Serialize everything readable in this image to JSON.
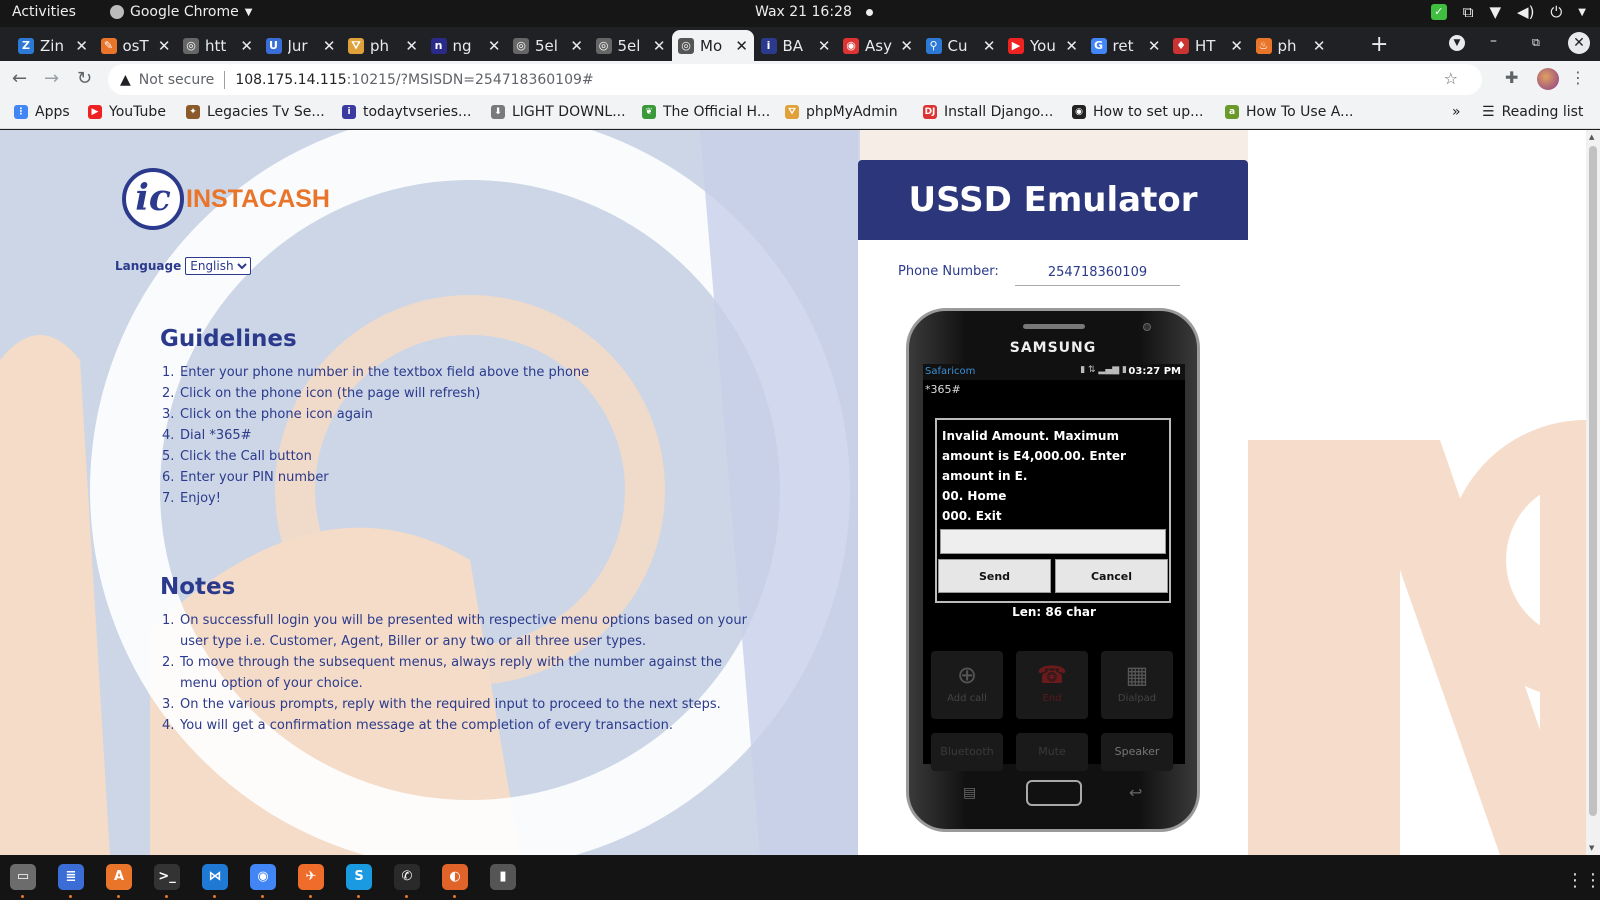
{
  "topbar": {
    "activities": "Activities",
    "app": "Google Chrome",
    "clock": "Wax 21  16:28"
  },
  "tabs": [
    {
      "title": "Zin",
      "fav": "Z",
      "color": "#2d7ad6"
    },
    {
      "title": "osT",
      "fav": "✎",
      "color": "#e8752a"
    },
    {
      "title": "htt",
      "fav": "◎",
      "color": "#666"
    },
    {
      "title": "Jur",
      "fav": "U",
      "color": "#3a6ed6"
    },
    {
      "title": "ph",
      "fav": "⛛",
      "color": "#e0a03a"
    },
    {
      "title": "ng",
      "fav": "n",
      "color": "#2a2a8a"
    },
    {
      "title": "5el",
      "fav": "◎",
      "color": "#666"
    },
    {
      "title": "5el",
      "fav": "◎",
      "color": "#666"
    },
    {
      "title": "Mo",
      "fav": "◎",
      "color": "#555"
    },
    {
      "title": "BA",
      "fav": "i",
      "color": "#2b3a8c"
    },
    {
      "title": "Asy",
      "fav": "◉",
      "color": "#d33"
    },
    {
      "title": "Cu",
      "fav": "⚲",
      "color": "#2d7ad6"
    },
    {
      "title": "You",
      "fav": "▶",
      "color": "#e22"
    },
    {
      "title": "ret",
      "fav": "G",
      "color": "#4285f4"
    },
    {
      "title": "HT",
      "fav": "♦",
      "color": "#c33"
    },
    {
      "title": "ph",
      "fav": "♨",
      "color": "#e8752a"
    }
  ],
  "omnibox": {
    "security": "Not secure",
    "host": "108.175.14.115",
    "path": ":10215/?MSISDN=254718360109#"
  },
  "bookmarks": [
    {
      "label": "Apps",
      "fav": "⋮",
      "color": "#4285f4"
    },
    {
      "label": "YouTube",
      "fav": "▶",
      "color": "#e22"
    },
    {
      "label": "Legacies Tv Se...",
      "fav": "✦",
      "color": "#8a5a2a"
    },
    {
      "label": "todaytvseries...",
      "fav": "i",
      "color": "#3a3aa0"
    },
    {
      "label": "LIGHT DOWNL...",
      "fav": "⬇",
      "color": "#7a7a7a"
    },
    {
      "label": "The Official H...",
      "fav": "❦",
      "color": "#3a9a3a"
    },
    {
      "label": "phpMyAdmin",
      "fav": "⛛",
      "color": "#e0a03a"
    },
    {
      "label": "Install Django...",
      "fav": "DJ",
      "color": "#d33"
    },
    {
      "label": "How to set up...",
      "fav": "◉",
      "color": "#222"
    },
    {
      "label": "How To Use A...",
      "fav": "a",
      "color": "#6a9a2a"
    }
  ],
  "bookmarks_more": "»",
  "reading_list": "Reading list",
  "page": {
    "logo_mark": "ic",
    "logo_text": "INSTACASH",
    "language_label": "Language",
    "language_selected": "English",
    "guidelines_title": "Guidelines",
    "guidelines": [
      "Enter your phone number in the textbox field above the phone",
      "Click on the phone icon (the page will refresh)",
      "Click on the phone icon again",
      "Dial *365#",
      "Click the Call button",
      "Enter your PIN number",
      "Enjoy!"
    ],
    "notes_title": "Notes",
    "notes": [
      "On successfull login you will be presented with respective menu options based on your user type i.e. Customer, Agent, Biller or any two or all three user types.",
      "To move through the subsequent menus, always reply with the number against the menu option of your choice.",
      "On the various prompts, reply with the required input to proceed to the next steps.",
      "You will get a confirmation message at the completion of every transaction."
    ]
  },
  "emulator": {
    "title": "USSD Emulator",
    "phone_label": "Phone Number:",
    "phone_value": "254718360109",
    "brand": "SAMSUNG",
    "carrier": "Safaricom",
    "time": "03:27 PM",
    "dial": "*365#",
    "message": [
      "Invalid Amount. Maximum",
      "amount is E4,000.00. Enter",
      "amount in E.",
      "00. Home",
      "000. Exit"
    ],
    "send": "Send",
    "cancel": "Cancel",
    "length": "Len: 86 char",
    "call_buttons": [
      "Add call",
      "End",
      "Dialpad",
      "Bluetooth",
      "Mute",
      "Speaker"
    ]
  },
  "dock": [
    {
      "name": "files",
      "glyph": "▭",
      "color": "#6c6c6c"
    },
    {
      "name": "text-editor",
      "glyph": "≣",
      "color": "#3a6ed6"
    },
    {
      "name": "software",
      "glyph": "A",
      "color": "#e8752a"
    },
    {
      "name": "terminal",
      "glyph": ">_",
      "color": "#333"
    },
    {
      "name": "vscode",
      "glyph": "⋈",
      "color": "#1f7ad6"
    },
    {
      "name": "chrome",
      "glyph": "◉",
      "color": "#4285f4"
    },
    {
      "name": "postman",
      "glyph": "✈",
      "color": "#ef6c2a"
    },
    {
      "name": "skype",
      "glyph": "S",
      "color": "#1a9ae0"
    },
    {
      "name": "whatsapp",
      "glyph": "✆",
      "color": "#2a2a2a"
    },
    {
      "name": "firefox",
      "glyph": "◐",
      "color": "#e0632a"
    },
    {
      "name": "usb-creator",
      "glyph": "▮",
      "color": "#555"
    }
  ]
}
